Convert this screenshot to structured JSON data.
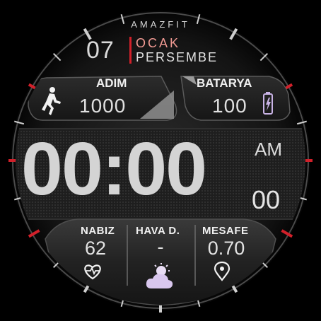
{
  "brand": "AMAZFIT",
  "date": {
    "day": "07",
    "month": "OCAK",
    "weekday": "PERSEMBE"
  },
  "steps": {
    "label": "ADIM",
    "value": "1000",
    "icon": "running-person-icon"
  },
  "battery": {
    "label": "BATARYA",
    "value": "100",
    "icon": "battery-icon"
  },
  "time": {
    "clock": "00:00",
    "ampm": "AM",
    "seconds": "00"
  },
  "stats": [
    {
      "label": "NABIZ",
      "value": "62",
      "icon": "heart-rate-icon"
    },
    {
      "label": "HAVA D.",
      "value": "-",
      "icon": "weather-cloud-icon"
    },
    {
      "label": "MESAFE",
      "value": "0.70",
      "icon": "location-pin-icon"
    }
  ],
  "colors": {
    "accent_red": "#d1202a",
    "month_pink": "#f19a93",
    "icon_lilac": "#d9c7ee"
  }
}
